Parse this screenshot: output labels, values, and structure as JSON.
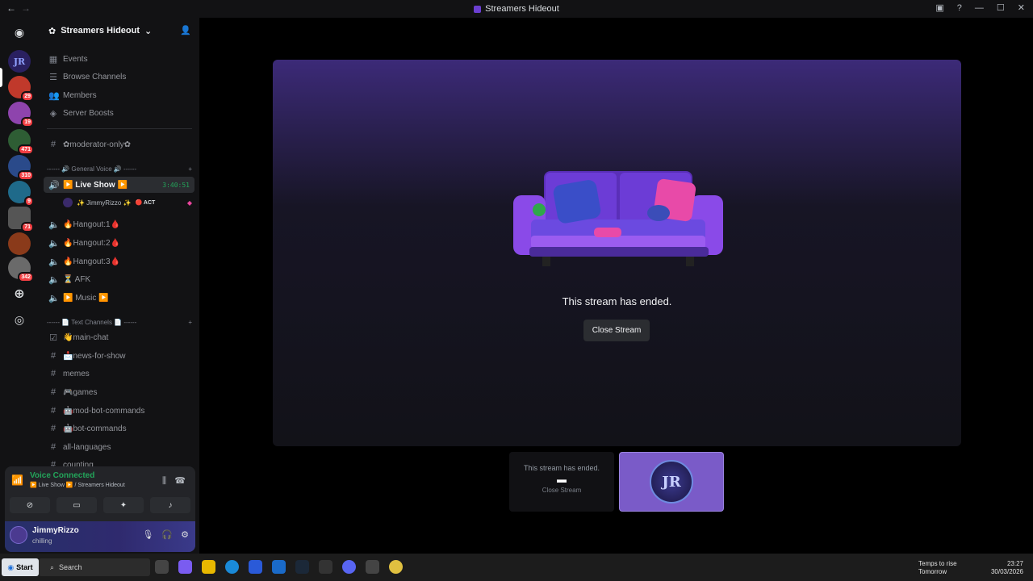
{
  "window": {
    "title": "Streamers Hideout"
  },
  "servers": [
    {
      "badge": "29"
    },
    {
      "badge": "19"
    },
    {
      "badge": "471"
    },
    {
      "badge": "310"
    },
    {
      "badge": "9"
    },
    {
      "badge": "71"
    },
    {
      "badge": "342"
    }
  ],
  "guild": {
    "name": "Streamers Hideout"
  },
  "menu": {
    "events": "Events",
    "browse": "Browse Channels",
    "members": "Members",
    "boosts": "Server Boosts"
  },
  "channels": {
    "moderator": "✿moderator-only✿",
    "cat_voice": "------ 🔊 General Voice 🔊 ------",
    "live": "▶️ Live Show ▶️",
    "live_timer": "3:40:51",
    "user_in_live": "✨ JimmyRizzo ✨",
    "user_activity": "🔴 ACT",
    "hangout1": "🔥Hangout:1🩸",
    "hangout2": "🔥Hangout:2🩸",
    "hangout3": "🔥Hangout:3🩸",
    "afk": "⏳ AFK",
    "music": "▶️ Music ▶️",
    "cat_text": "------ 📄 Text Channels 📄 ------",
    "main_chat": "👋main-chat",
    "news": "📩news-for-show",
    "memes": "memes",
    "games": "🎮games",
    "modbot": "🤖mod-bot-commands",
    "bot": "🤖bot-commands",
    "languages": "all-languages",
    "counting": "counting"
  },
  "voice": {
    "status": "Voice Connected",
    "location": "▶️ Live Show ▶️ / Streamers Hideout"
  },
  "user": {
    "name": "JimmyRizzo",
    "status": "chilling"
  },
  "stream": {
    "ended_text": "This stream has ended.",
    "close_label": "Close Stream"
  },
  "thumb": {
    "ended_text": "This stream has ended.",
    "close_label": "Close Stream",
    "logo_text": "JR"
  },
  "taskbar": {
    "start": "Start",
    "search": "Search",
    "weather_title": "Temps to rise",
    "weather_sub": "Tomorrow",
    "time": "23:27",
    "date": "30/03/2026"
  }
}
